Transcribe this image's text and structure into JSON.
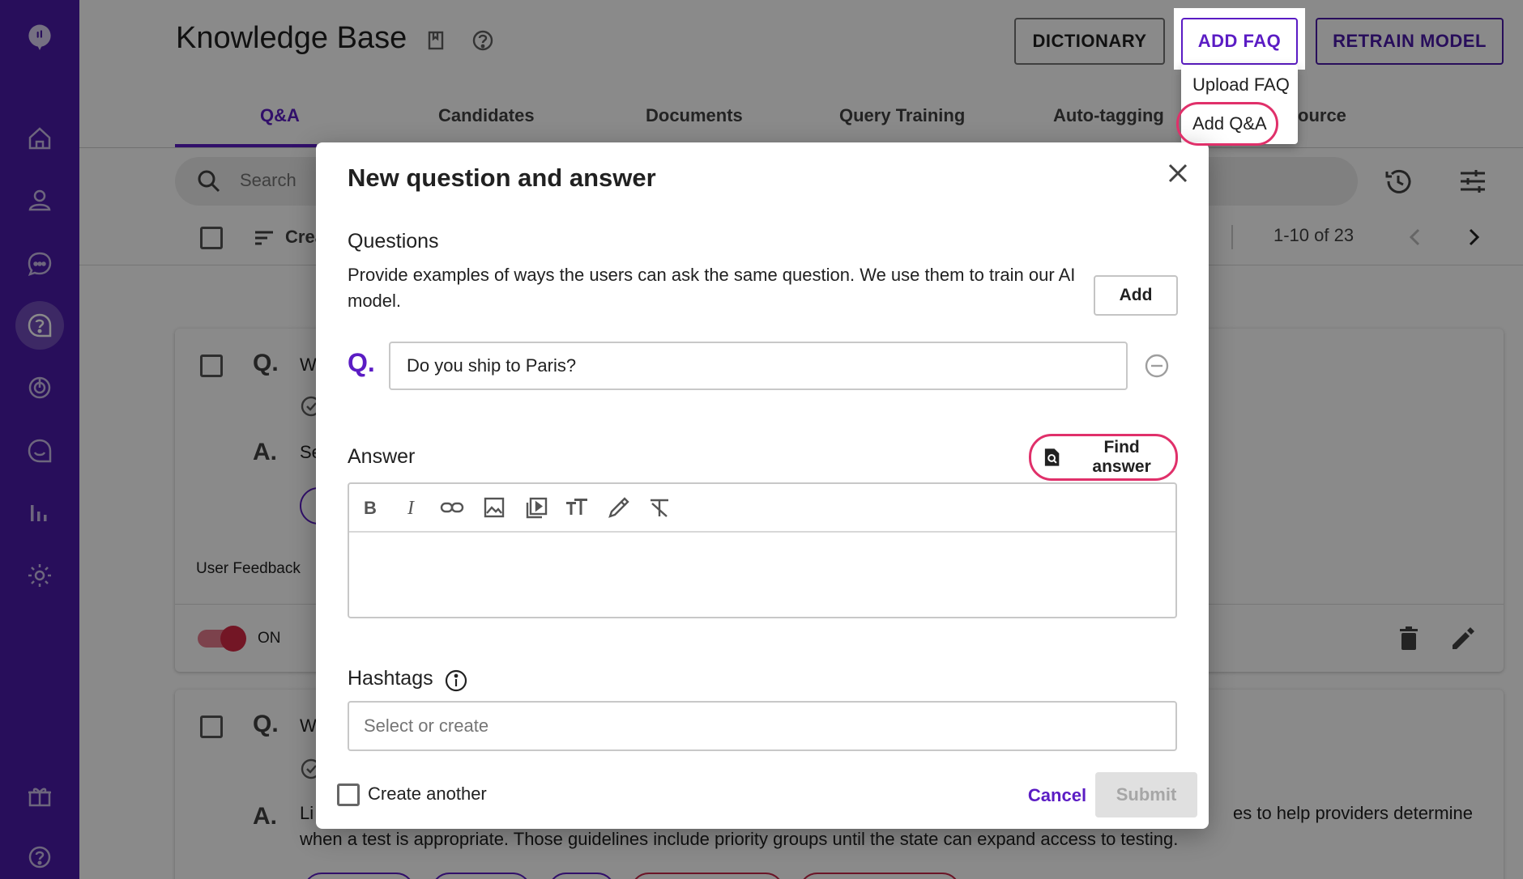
{
  "header": {
    "title": "Knowledge Base",
    "dictionary_label": "DICTIONARY",
    "add_faq_label": "ADD FAQ",
    "retrain_label": "RETRAIN MODEL"
  },
  "add_faq_menu": {
    "items": [
      "Upload FAQ",
      "Add Q&A"
    ],
    "highlighted": "Add Q&A"
  },
  "tabs": [
    {
      "label": "Q&A",
      "active": true
    },
    {
      "label": "Candidates"
    },
    {
      "label": "Documents"
    },
    {
      "label": "Query Training"
    },
    {
      "label": "Auto-tagging"
    },
    {
      "label": "ource"
    }
  ],
  "toolbar": {
    "search_placeholder": "Search",
    "sort_label": "Crea",
    "pagination": "1-10 of 23"
  },
  "cards": [
    {
      "q_letter": "Q.",
      "q_text": "W",
      "a_letter": "A.",
      "a_text": "Se",
      "feedback_label": "User Feedback",
      "toggle_label": "ON"
    },
    {
      "q_letter": "Q.",
      "q_text": "W",
      "a_letter": "A.",
      "a_text_line1": "Li",
      "a_text_line1_tail": "es to help providers determine",
      "a_text_line2": "when a test is appropriate. Those guidelines include priority groups until the state can expand access to testing."
    }
  ],
  "modal": {
    "title": "New question and answer",
    "questions_heading": "Questions",
    "questions_desc": "Provide examples of ways the users can ask the same question. We use them to train our AI model.",
    "add_label": "Add",
    "q_mark": "Q.",
    "question_value": "Do you ship to Paris?",
    "answer_heading": "Answer",
    "find_answer_label": "Find answer",
    "hashtags_heading": "Hashtags",
    "hashtags_placeholder": "Select or create",
    "create_another_label": "Create another",
    "cancel_label": "Cancel",
    "submit_label": "Submit"
  },
  "colors": {
    "brand": "#4a1aa8",
    "accent": "#5b1cc4",
    "highlight": "#e0306a"
  }
}
